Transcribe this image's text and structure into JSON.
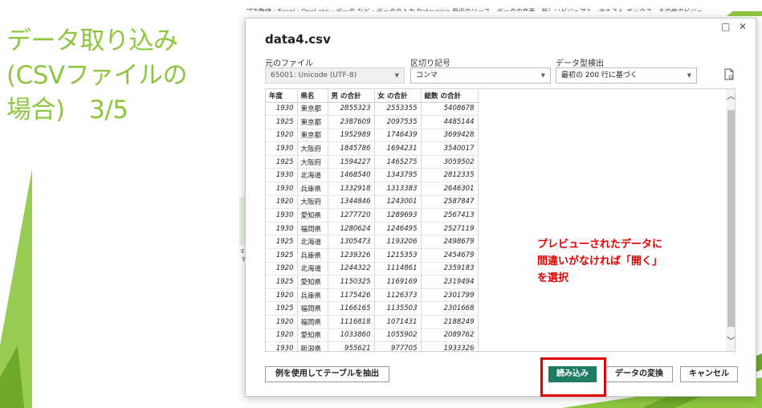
{
  "slide": {
    "title_lines": [
      "データ取り込み",
      "(CSVファイルの",
      "場合)　3/5"
    ]
  },
  "background_app": {
    "strip_text": "プで数値・Excel・OneLake・データ など・データの入力 Dataverse 最近のソース　データの変更　新しいビジュアル　テキスト ボックス　その他のビジュ",
    "side_marks": [
      "E",
      "す"
    ]
  },
  "dialog": {
    "title": "data4.csv",
    "window_controls": {
      "restore": "□",
      "close": "✕"
    },
    "file_origin": {
      "label": "元のファイル",
      "value": "65001: Unicode (UTF-8)"
    },
    "delimiter": {
      "label": "区切り記号",
      "value": "コンマ"
    },
    "type_detection": {
      "label": "データ型検出",
      "value": "最初の 200 行に基づく"
    },
    "table": {
      "columns": [
        "年度",
        "県名",
        "男 の合計",
        "女 の合計",
        "総数 の合計"
      ],
      "rows": [
        [
          "1930",
          "東京都",
          "2855323",
          "2553355",
          "5408678"
        ],
        [
          "1925",
          "東京都",
          "2387609",
          "2097535",
          "4485144"
        ],
        [
          "1920",
          "東京都",
          "1952989",
          "1746439",
          "3699428"
        ],
        [
          "1930",
          "大阪府",
          "1845786",
          "1694231",
          "3540017"
        ],
        [
          "1925",
          "大阪府",
          "1594227",
          "1465275",
          "3059502"
        ],
        [
          "1930",
          "北海道",
          "1468540",
          "1343795",
          "2812335"
        ],
        [
          "1930",
          "兵庫県",
          "1332918",
          "1313383",
          "2646301"
        ],
        [
          "1920",
          "大阪府",
          "1344846",
          "1243001",
          "2587847"
        ],
        [
          "1930",
          "愛知県",
          "1277720",
          "1289693",
          "2567413"
        ],
        [
          "1930",
          "福岡県",
          "1280624",
          "1246495",
          "2527119"
        ],
        [
          "1925",
          "北海道",
          "1305473",
          "1193206",
          "2498679"
        ],
        [
          "1925",
          "兵庫県",
          "1239326",
          "1215353",
          "2454679"
        ],
        [
          "1920",
          "北海道",
          "1244322",
          "1114861",
          "2359183"
        ],
        [
          "1925",
          "愛知県",
          "1150325",
          "1169169",
          "2319494"
        ],
        [
          "1920",
          "兵庫県",
          "1175426",
          "1126373",
          "2301799"
        ],
        [
          "1925",
          "福岡県",
          "1166165",
          "1135503",
          "2301668"
        ],
        [
          "1920",
          "福岡県",
          "1116818",
          "1071431",
          "2188249"
        ],
        [
          "1920",
          "愛知県",
          "1033860",
          "1055902",
          "2089762"
        ],
        [
          "1930",
          "新潟県",
          "955621",
          "977705",
          "1933326"
        ]
      ]
    },
    "annotation_lines": [
      "プレビューされたデータに",
      "間違いがなければ「開く」",
      "を選択"
    ],
    "buttons": {
      "extract": "例を使用してテーブルを抽出",
      "load": "読み込み",
      "transform": "データの変換",
      "cancel": "キャンセル"
    }
  },
  "colors": {
    "title_green": "#8dc63f",
    "primary_button": "#1e7c64",
    "annotation_red": "#e60000"
  }
}
